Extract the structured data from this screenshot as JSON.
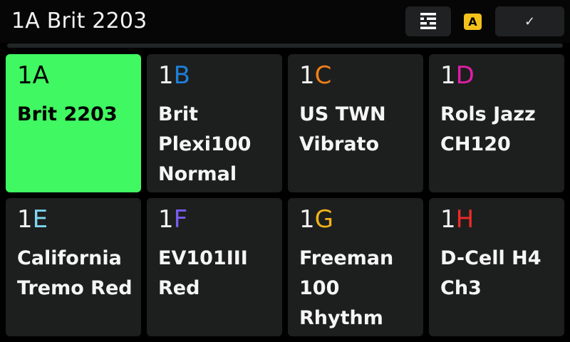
{
  "header": {
    "title": "1A Brit 2203",
    "bank_badge": "A",
    "grid_icon": "grid-layout-icon",
    "confirm_icon": "checkmark-icon",
    "confirm_glyph": "✓"
  },
  "colors": {
    "selected_bg": "#40f862",
    "tile_bg": "#1d1f1e",
    "badge_bg": "#f2c21b"
  },
  "presets": [
    {
      "number": "1",
      "letter": "A",
      "letter_color": "#000000",
      "name": "Brit 2203",
      "selected": true
    },
    {
      "number": "1",
      "letter": "B",
      "letter_color": "#1e7fd8",
      "name": "Brit Plexi100 Normal",
      "selected": false
    },
    {
      "number": "1",
      "letter": "C",
      "letter_color": "#f08018",
      "name": "US TWN Vibrato",
      "selected": false
    },
    {
      "number": "1",
      "letter": "D",
      "letter_color": "#e21ca8",
      "name": "Rols Jazz CH120",
      "selected": false
    },
    {
      "number": "1",
      "letter": "E",
      "letter_color": "#7fd6f2",
      "name": "California Tremo Red",
      "selected": false
    },
    {
      "number": "1",
      "letter": "F",
      "letter_color": "#7b5cf0",
      "name": "EV101III Red",
      "selected": false
    },
    {
      "number": "1",
      "letter": "G",
      "letter_color": "#f2b21c",
      "name": "Freeman 100 Rhythm",
      "selected": false
    },
    {
      "number": "1",
      "letter": "H",
      "letter_color": "#ee2a28",
      "name": "D-Cell H4 Ch3",
      "selected": false
    }
  ]
}
